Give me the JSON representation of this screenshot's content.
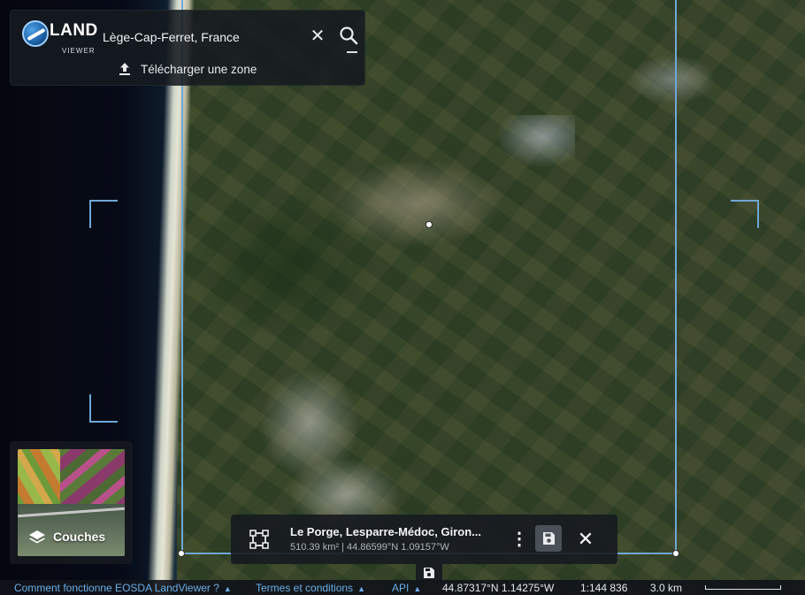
{
  "app": {
    "logo_land": "LAND",
    "logo_viewer": "VIEWER"
  },
  "search": {
    "value": "Lège-Cap-Ferret, France",
    "upload_label": "Télécharger une zone"
  },
  "layers": {
    "label": "Couches"
  },
  "aoi_info": {
    "title": "Le Porge, Lesparre-Médoc, Giron...",
    "subtitle": "510.39 km² | 44.86599°N 1.09157°W"
  },
  "footer": {
    "how_link": "Comment fonctionne EOSDA LandViewer ?",
    "terms_link": "Termes et conditions",
    "api_link": "API",
    "coords": "44.87317°N 1.14275°W",
    "scale_ratio": "1:144 836",
    "scale_distance": "3.0 km"
  },
  "icons": {
    "search": "search-icon",
    "clear": "close-icon",
    "upload": "upload-icon",
    "layers": "layers-icon",
    "aoi": "polygon-select-icon",
    "more": "more-vertical-icon",
    "save": "save-icon",
    "close": "close-icon"
  },
  "colors": {
    "accent": "#6fa7d6",
    "link": "#6aaee8",
    "panel": "#161a20"
  }
}
